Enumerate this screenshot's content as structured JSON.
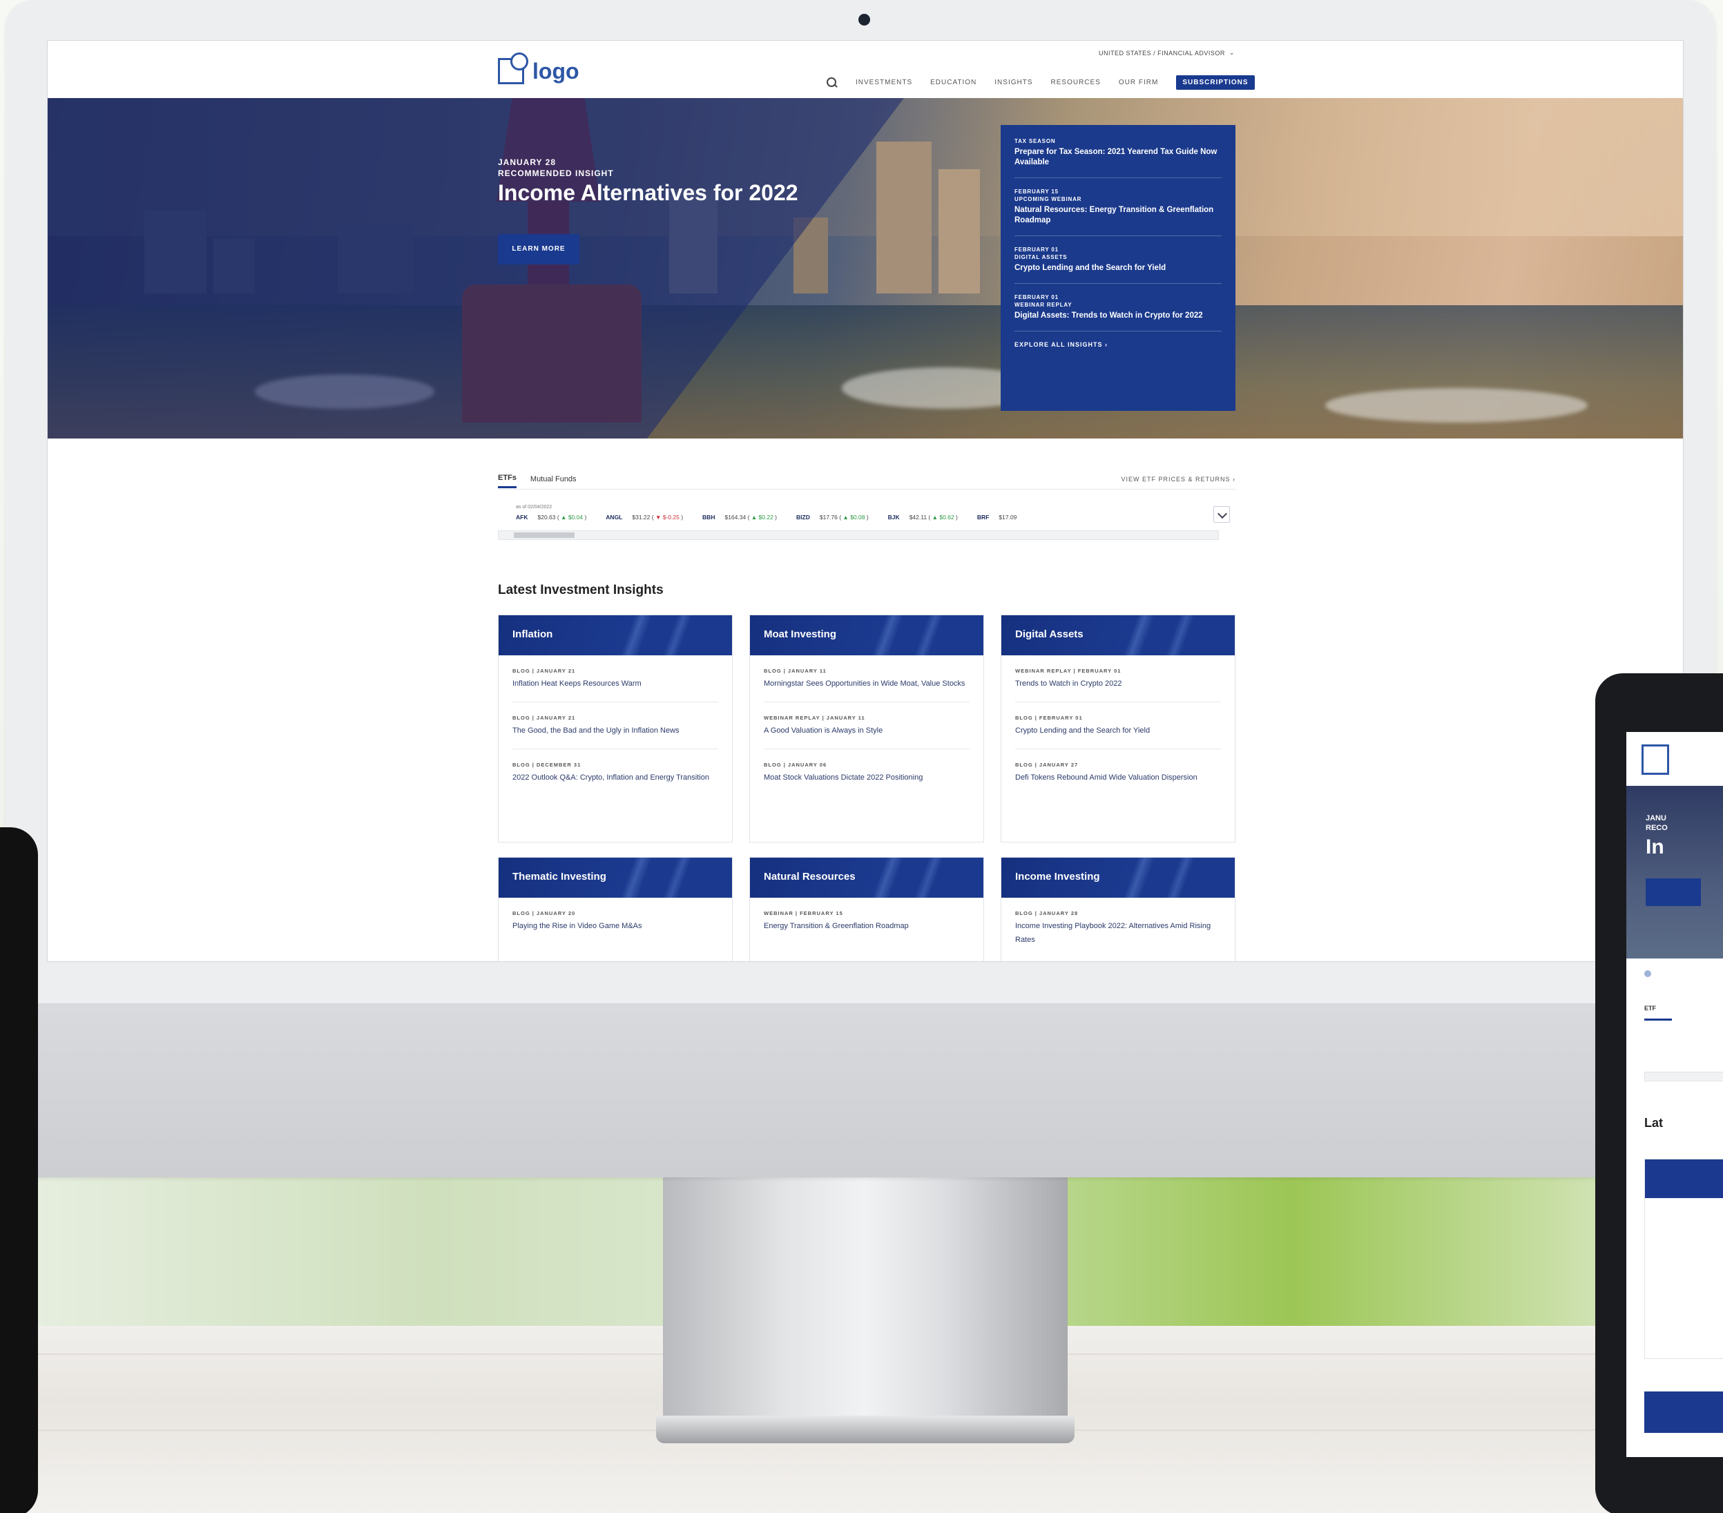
{
  "header": {
    "logo_text": "logo",
    "region_selector": "UNITED STATES / FINANCIAL ADVISOR",
    "nav": [
      "INVESTMENTS",
      "EDUCATION",
      "INSIGHTS",
      "RESOURCES",
      "OUR FIRM"
    ],
    "subscribe_label": "SUBSCRIPTIONS"
  },
  "hero": {
    "date": "JANUARY 28",
    "eyebrow": "RECOMMENDED INSIGHT",
    "title": "Income Alternatives for 2022",
    "button_label": "LEARN MORE"
  },
  "insights_panel": {
    "items": [
      {
        "meta1": "TAX SEASON",
        "meta2": "",
        "title": "Prepare for Tax Season: 2021 Yearend Tax Guide Now Available"
      },
      {
        "meta1": "FEBRUARY 15",
        "meta2": "UPCOMING WEBINAR",
        "title": "Natural Resources: Energy Transition & Greenflation Roadmap"
      },
      {
        "meta1": "FEBRUARY 01",
        "meta2": "DIGITAL ASSETS",
        "title": "Crypto Lending and the Search for Yield"
      },
      {
        "meta1": "FEBRUARY 01",
        "meta2": "WEBINAR REPLAY",
        "title": "Digital Assets: Trends to Watch in Crypto for 2022"
      }
    ],
    "explore_label": "EXPLORE ALL INSIGHTS"
  },
  "ticker": {
    "tabs": [
      "ETFs",
      "Mutual Funds"
    ],
    "view_link": "VIEW ETF PRICES & RETURNS",
    "as_of": "as of 02/04/2022",
    "rows": [
      {
        "symbol": "AFK",
        "price": "$20.63",
        "change": "▲ $0.04"
      },
      {
        "symbol": "ANGL",
        "price": "$31.22",
        "change": "▼ $-0.25"
      },
      {
        "symbol": "BBH",
        "price": "$164.34",
        "change": "▲ $0.22"
      },
      {
        "symbol": "BIZD",
        "price": "$17.76",
        "change": "▲ $0.08"
      },
      {
        "symbol": "BJK",
        "price": "$42.11",
        "change": "▲ $0.62"
      },
      {
        "symbol": "BRF",
        "price": "$17.09",
        "change": ""
      }
    ]
  },
  "latest": {
    "title": "Latest Investment Insights",
    "cards": [
      {
        "title": "Inflation",
        "items": [
          {
            "meta": "BLOG | JANUARY 21",
            "title": "Inflation Heat Keeps Resources Warm"
          },
          {
            "meta": "BLOG | JANUARY 21",
            "title": "The Good, the Bad and the Ugly in Inflation News"
          },
          {
            "meta": "BLOG | DECEMBER 31",
            "title": "2022 Outlook Q&A: Crypto, Inflation and Energy Transition"
          }
        ]
      },
      {
        "title": "Moat Investing",
        "items": [
          {
            "meta": "BLOG | JANUARY 11",
            "title": "Morningstar Sees Opportunities in Wide Moat, Value Stocks"
          },
          {
            "meta": "WEBINAR REPLAY | JANUARY 11",
            "title": "A Good Valuation is Always in Style"
          },
          {
            "meta": "BLOG | JANUARY 06",
            "title": "Moat Stock Valuations Dictate 2022 Positioning"
          }
        ]
      },
      {
        "title": "Digital Assets",
        "items": [
          {
            "meta": "WEBINAR REPLAY | FEBRUARY 01",
            "title": "Trends to Watch in Crypto 2022"
          },
          {
            "meta": "BLOG | FEBRUARY 01",
            "title": "Crypto Lending and the Search for Yield"
          },
          {
            "meta": "BLOG | JANUARY 27",
            "title": "Defi Tokens Rebound Amid Wide Valuation Dispersion"
          }
        ]
      },
      {
        "title": "Thematic Investing",
        "items": [
          {
            "meta": "BLOG | JANUARY 20",
            "title": "Playing the Rise in Video Game M&As"
          }
        ]
      },
      {
        "title": "Natural Resources",
        "items": [
          {
            "meta": "WEBINAR | FEBRUARY 15",
            "title": "Energy Transition & Greenflation Roadmap"
          }
        ]
      },
      {
        "title": "Income Investing",
        "items": [
          {
            "meta": "BLOG | JANUARY 28",
            "title": "Income Investing Playbook 2022: Alternatives Amid Rising Rates"
          }
        ]
      }
    ]
  },
  "tablet": {
    "date": "JANU",
    "eyebrow": "RECO",
    "title": "In",
    "tab": "ETF",
    "section": "Lat"
  },
  "colors": {
    "brand_blue": "#1b3a8f",
    "logo_blue": "#2d56a6",
    "up": "#2e9b45",
    "down": "#d0303b"
  }
}
